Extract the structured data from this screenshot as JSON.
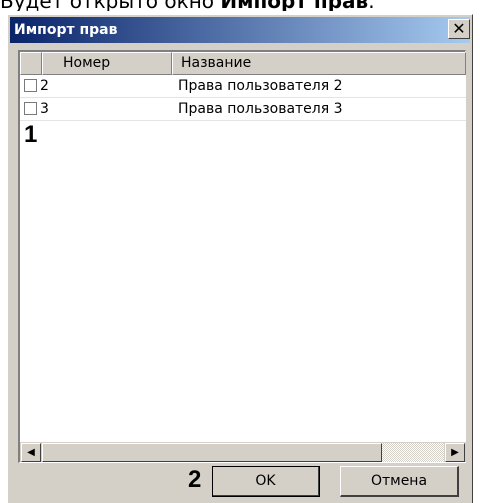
{
  "page_text": {
    "prefix": "Будет открыто окно ",
    "bold": "Импорт прав",
    "suffix": "."
  },
  "dialog": {
    "title": "Импорт прав",
    "close_glyph": "✕"
  },
  "list": {
    "columns": [
      "Номер",
      "Название"
    ],
    "rows": [
      {
        "checked": false,
        "number": "2",
        "name": "Права пользователя 2"
      },
      {
        "checked": false,
        "number": "3",
        "name": "Права пользователя 3"
      }
    ]
  },
  "scrollbar": {
    "left_arrow": "◀",
    "right_arrow": "▶"
  },
  "markers": {
    "list": "1",
    "buttons": "2"
  },
  "buttons": {
    "ok": "OK",
    "cancel": "Отмена"
  },
  "colors": {
    "titlebar_start": "#0a246a",
    "titlebar_end": "#a6caf0",
    "face": "#d4d0c8"
  }
}
